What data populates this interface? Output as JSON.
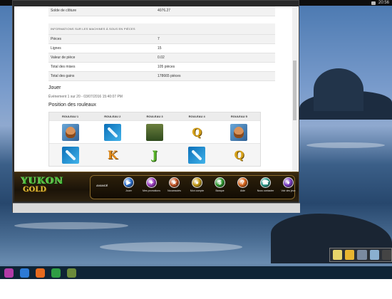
{
  "system": {
    "clock": "20:56"
  },
  "info": {
    "closing_balance_label": "Solde de clôture",
    "closing_balance_value": "4076.27",
    "section_title": "INFORMATIONS SUR LES MACHINES À SOUS EN PIÈCES",
    "rows": [
      {
        "label": "Pièces",
        "value": "7"
      },
      {
        "label": "Lignes",
        "value": "15"
      },
      {
        "label": "Valeur de pièce",
        "value": "0.02"
      },
      {
        "label": "Total des mises",
        "value": "105 pièces"
      },
      {
        "label": "Total des gains",
        "value": "178665 pièces"
      }
    ]
  },
  "play": {
    "heading": "Jouer",
    "event_line": "Événement 1 sur 20 - 03/07/2016 15:40:07 PM",
    "reels_heading": "Position des rouleaux",
    "reel_headers": [
      "ROULEAU 1",
      "ROULEAU 2",
      "ROULEAU 3",
      "ROULEAU 4",
      "ROULEAU 5"
    ],
    "reel_rows": [
      [
        "prospector",
        "ice-axe",
        "tent",
        "Q",
        "prospector"
      ],
      [
        "ice-axe",
        "K",
        "J",
        "ice-axe",
        "Q"
      ]
    ]
  },
  "casino": {
    "logo_line1": "YUKON",
    "logo_line2": "GOLD",
    "menu_label": "AVANCÉ",
    "menu": [
      {
        "label": "Jouer",
        "color": "#2a6fd0",
        "glyph": "▶"
      },
      {
        "label": "Mes promotions",
        "color": "#9c3cc2",
        "glyph": "✦"
      },
      {
        "label": "Nouveautés",
        "color": "#c05020",
        "glyph": "★"
      },
      {
        "label": "Mon compte",
        "color": "#c59a15",
        "glyph": "●"
      },
      {
        "label": "Banque",
        "color": "#2f9a2f",
        "glyph": "$"
      },
      {
        "label": "Aide",
        "color": "#d9641a",
        "glyph": "?"
      },
      {
        "label": "Nous contacter",
        "color": "#2a9a8a",
        "glyph": "☎"
      },
      {
        "label": "Voir des jeux",
        "color": "#7a3cc2",
        "glyph": "♦"
      }
    ]
  },
  "taskbar": {
    "icons": [
      {
        "name": "chat",
        "color": "#b13aa6"
      },
      {
        "name": "slot-app",
        "color": "#2c7ad6"
      },
      {
        "name": "firefox",
        "color": "#e66a1e"
      },
      {
        "name": "chrome",
        "color": "#2e9e44"
      },
      {
        "name": "casino",
        "color": "#6b8a3a"
      }
    ]
  },
  "tray_flyout": {
    "icons": [
      {
        "name": "folder",
        "color": "#e7d46a"
      },
      {
        "name": "smiley",
        "color": "#e8b530"
      },
      {
        "name": "gamepad",
        "color": "#7a8aa0"
      },
      {
        "name": "network",
        "color": "#8ab0d0"
      },
      {
        "name": "car",
        "color": "#444444"
      }
    ]
  }
}
